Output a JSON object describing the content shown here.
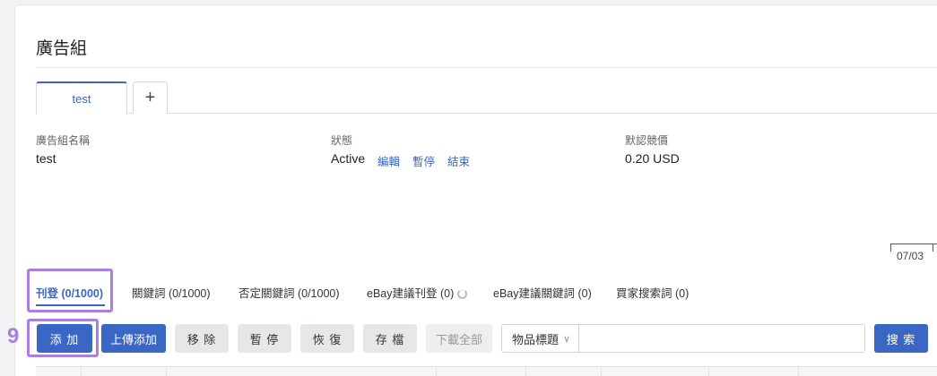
{
  "header": {
    "title": "廣告組"
  },
  "tabs": [
    {
      "label": "test"
    }
  ],
  "info": {
    "name": {
      "label": "廣告組名稱",
      "value": "test"
    },
    "status": {
      "label": "狀態",
      "value": "Active",
      "actions": [
        "編輯",
        "暫停",
        "結束"
      ]
    },
    "default_bid": {
      "label": "默認競價",
      "value": "0.20 USD"
    }
  },
  "chart": {
    "date_label": "07/03"
  },
  "subtabs": [
    {
      "label": "刊登 (0/1000)",
      "active": true
    },
    {
      "label": "關鍵詞 (0/1000)"
    },
    {
      "label": "否定關鍵詞 (0/1000)"
    },
    {
      "label": "eBay建議刊登 (0)"
    },
    {
      "label": "eBay建議關鍵詞 (0)"
    },
    {
      "label": "買家搜索詞 (0)"
    }
  ],
  "marker": "9",
  "toolbar": {
    "add": "添 加",
    "upload_add": "上傳添加",
    "remove": "移 除",
    "pause": "暫 停",
    "resume": "恢 復",
    "archive": "存 檔",
    "download_all": "下載全部",
    "filter_select": "物品標題",
    "search_placeholder": "",
    "search": "搜 索"
  },
  "colors": {
    "accent": "#3a66c4",
    "highlight": "#a97fe3"
  }
}
